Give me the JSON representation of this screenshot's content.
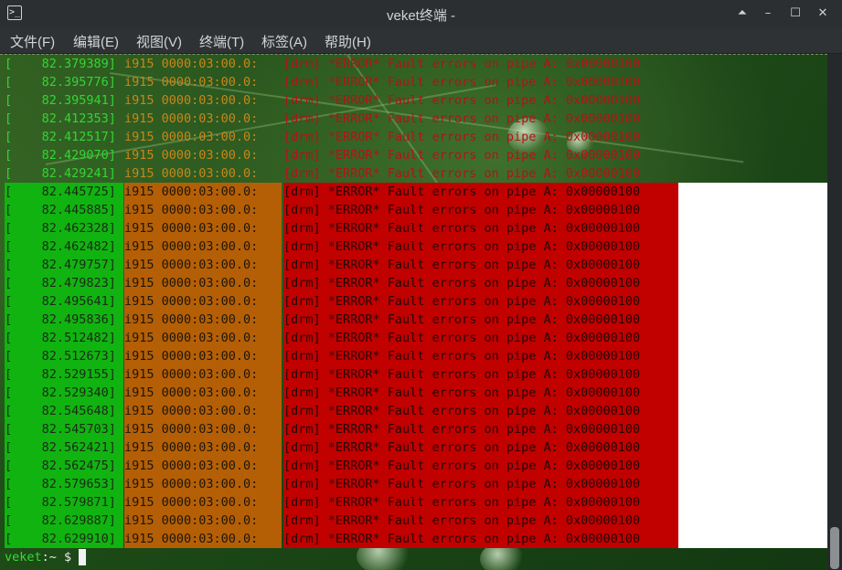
{
  "window": {
    "title": "veket终端 -"
  },
  "menu": [
    "文件(F)",
    "编辑(E)",
    "视图(V)",
    "终端(T)",
    "标签(A)",
    "帮助(H)"
  ],
  "log_ghost": [
    [
      "[    82.379389]",
      "i915 0000:03:00.0:",
      "[drm] *ERROR* Fault errors on pipe A: 0x00000100"
    ],
    [
      "[    82.395776]",
      "i915 0000:03:00.0:",
      "[drm] *ERROR* Fault errors on pipe A: 0x00000100"
    ],
    [
      "[    82.395941]",
      "i915 0000:03:00.0:",
      "[drm] *ERROR* Fault errors on pipe A: 0x00000100"
    ],
    [
      "[    82.412353]",
      "i915 0000:03:00.0:",
      "[drm] *ERROR* Fault errors on pipe A: 0x00000100"
    ],
    [
      "[    82.412517]",
      "i915 0000:03:00.0:",
      "[drm] *ERROR* Fault errors on pipe A: 0x00000100"
    ],
    [
      "[    82.429070]",
      "i915 0000:03:00.0:",
      "[drm] *ERROR* Fault errors on pipe A: 0x00000100"
    ],
    [
      "[    82.429241]",
      "i915 0000:03:00.0:",
      "[drm] *ERROR* Fault errors on pipe A: 0x00000100"
    ]
  ],
  "log_solid": [
    [
      "[    82.445725]",
      "i915 0000:03:00.0:",
      "[drm] *ERROR* Fault errors on pipe A: 0x00000100"
    ],
    [
      "[    82.445885]",
      "i915 0000:03:00.0:",
      "[drm] *ERROR* Fault errors on pipe A: 0x00000100"
    ],
    [
      "[    82.462328]",
      "i915 0000:03:00.0:",
      "[drm] *ERROR* Fault errors on pipe A: 0x00000100"
    ],
    [
      "[    82.462482]",
      "i915 0000:03:00.0:",
      "[drm] *ERROR* Fault errors on pipe A: 0x00000100"
    ],
    [
      "[    82.479757]",
      "i915 0000:03:00.0:",
      "[drm] *ERROR* Fault errors on pipe A: 0x00000100"
    ],
    [
      "[    82.479823]",
      "i915 0000:03:00.0:",
      "[drm] *ERROR* Fault errors on pipe A: 0x00000100"
    ],
    [
      "[    82.495641]",
      "i915 0000:03:00.0:",
      "[drm] *ERROR* Fault errors on pipe A: 0x00000100"
    ],
    [
      "[    82.495836]",
      "i915 0000:03:00.0:",
      "[drm] *ERROR* Fault errors on pipe A: 0x00000100"
    ],
    [
      "[    82.512482]",
      "i915 0000:03:00.0:",
      "[drm] *ERROR* Fault errors on pipe A: 0x00000100"
    ],
    [
      "[    82.512673]",
      "i915 0000:03:00.0:",
      "[drm] *ERROR* Fault errors on pipe A: 0x00000100"
    ],
    [
      "[    82.529155]",
      "i915 0000:03:00.0:",
      "[drm] *ERROR* Fault errors on pipe A: 0x00000100"
    ],
    [
      "[    82.529340]",
      "i915 0000:03:00.0:",
      "[drm] *ERROR* Fault errors on pipe A: 0x00000100"
    ],
    [
      "[    82.545648]",
      "i915 0000:03:00.0:",
      "[drm] *ERROR* Fault errors on pipe A: 0x00000100"
    ],
    [
      "[    82.545703]",
      "i915 0000:03:00.0:",
      "[drm] *ERROR* Fault errors on pipe A: 0x00000100"
    ],
    [
      "[    82.562421]",
      "i915 0000:03:00.0:",
      "[drm] *ERROR* Fault errors on pipe A: 0x00000100"
    ],
    [
      "[    82.562475]",
      "i915 0000:03:00.0:",
      "[drm] *ERROR* Fault errors on pipe A: 0x00000100"
    ],
    [
      "[    82.579653]",
      "i915 0000:03:00.0:",
      "[drm] *ERROR* Fault errors on pipe A: 0x00000100"
    ],
    [
      "[    82.579871]",
      "i915 0000:03:00.0:",
      "[drm] *ERROR* Fault errors on pipe A: 0x00000100"
    ],
    [
      "[    82.629887]",
      "i915 0000:03:00.0:",
      "[drm] *ERROR* Fault errors on pipe A: 0x00000100"
    ],
    [
      "[    82.629910]",
      "i915 0000:03:00.0:",
      "[drm] *ERROR* Fault errors on pipe A: 0x00000100"
    ]
  ],
  "prompt": {
    "user": "veket",
    "path": ":~",
    "symbol": "$"
  },
  "colors": {
    "timestamp_bg": "#11b311",
    "device_bg": "#b45f06",
    "message_bg": "#c10000",
    "prompt_user": "#33dd33"
  },
  "icons": {
    "app": "terminal-icon",
    "minimize": "minimize-icon",
    "restore": "restore-icon",
    "maximize": "maximize-icon",
    "close": "close-icon"
  }
}
